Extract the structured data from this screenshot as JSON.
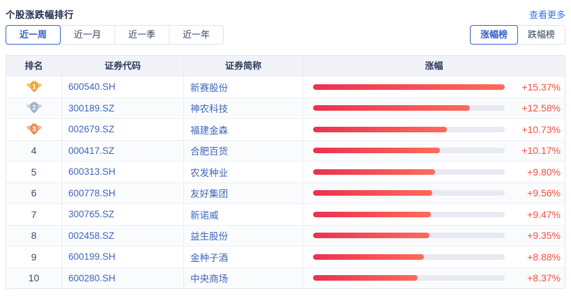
{
  "header": {
    "title": "个股涨跌幅排行",
    "more_link": "查看更多"
  },
  "period_tabs": [
    {
      "label": "近一周",
      "active": true
    },
    {
      "label": "近一月",
      "active": false
    },
    {
      "label": "近一季",
      "active": false
    },
    {
      "label": "近一年",
      "active": false
    }
  ],
  "board_tabs": [
    {
      "label": "涨幅榜",
      "active": true
    },
    {
      "label": "跌幅榜",
      "active": false
    }
  ],
  "table": {
    "columns": [
      "排名",
      "证券代码",
      "证券简称",
      "涨幅"
    ],
    "max_value": 15.37,
    "rows": [
      {
        "rank": 1,
        "code": "600540.SH",
        "name": "新赛股份",
        "change": "+15.37%",
        "value": 15.37
      },
      {
        "rank": 2,
        "code": "300189.SZ",
        "name": "神农科技",
        "change": "+12.58%",
        "value": 12.58
      },
      {
        "rank": 3,
        "code": "002679.SZ",
        "name": "福建金森",
        "change": "+10.73%",
        "value": 10.73
      },
      {
        "rank": 4,
        "code": "000417.SZ",
        "name": "合肥百货",
        "change": "+10.17%",
        "value": 10.17
      },
      {
        "rank": 5,
        "code": "600313.SH",
        "name": "农发种业",
        "change": "+9.80%",
        "value": 9.8
      },
      {
        "rank": 6,
        "code": "600778.SH",
        "name": "友好集团",
        "change": "+9.56%",
        "value": 9.56
      },
      {
        "rank": 7,
        "code": "300765.SZ",
        "name": "新诺威",
        "change": "+9.47%",
        "value": 9.47
      },
      {
        "rank": 8,
        "code": "002458.SZ",
        "name": "益生股份",
        "change": "+9.35%",
        "value": 9.35
      },
      {
        "rank": 9,
        "code": "600199.SH",
        "name": "金种子酒",
        "change": "+8.88%",
        "value": 8.88
      },
      {
        "rank": 10,
        "code": "600280.SH",
        "name": "中央商场",
        "change": "+8.37%",
        "value": 8.37
      }
    ]
  },
  "colors": {
    "accent_blue": "#3861c9",
    "link_blue": "#3b73de",
    "text_blue": "#4066bb",
    "rise_red": "#fa4e3e",
    "bar_gradient_start": "#ec3150",
    "bar_gradient_end": "#ff6a5a",
    "bar_track": "#e9e9f2",
    "medal_gold": "#f0a53a",
    "medal_gold_light": "#f6c66a",
    "medal_silver": "#9db0c6",
    "medal_silver_light": "#c9d4e0",
    "medal_bronze": "#e68e55",
    "medal_bronze_light": "#f2b489"
  }
}
